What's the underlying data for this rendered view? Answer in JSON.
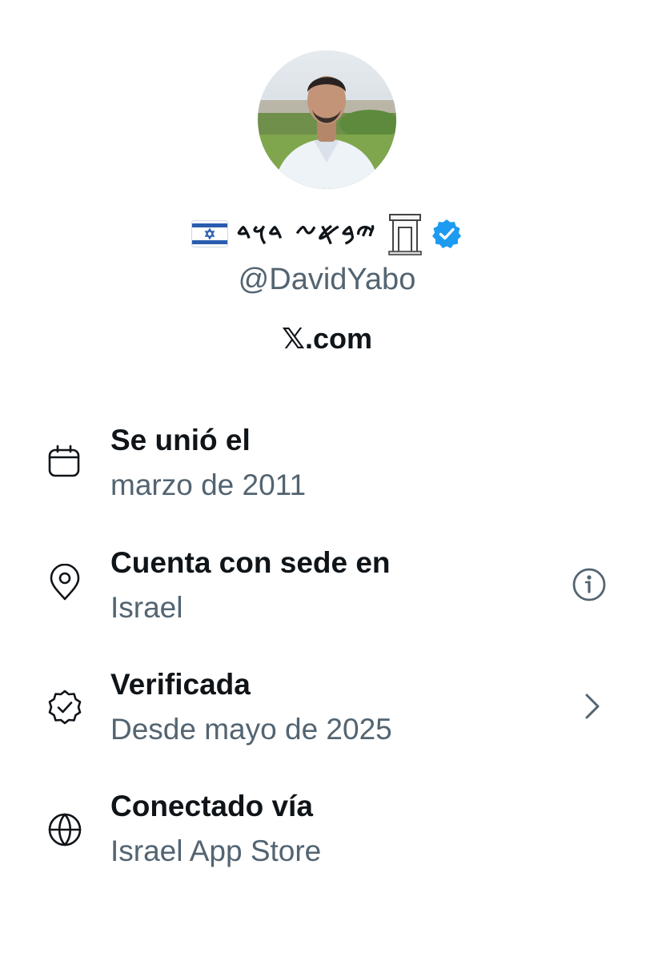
{
  "profile": {
    "display_name": "𐤉𐤁𐤀𐤆 𐤃𐤅𐤃",
    "handle": "@DavidYabo",
    "site_label": "𝕏.com",
    "flag_icon": "israel-flag-icon",
    "gate_icon": "gate-icon",
    "verified_icon": "verified-badge-icon",
    "verified_color": "#1d9bf0"
  },
  "info": [
    {
      "label": "Se unió el",
      "value": "marzo de 2011",
      "icon": "calendar-icon"
    },
    {
      "label": "Cuenta con sede en",
      "value": "Israel",
      "icon": "location-pin-icon",
      "action_icon": "info-icon"
    },
    {
      "label": "Verificada",
      "value": "Desde mayo de 2025",
      "icon": "verified-outline-icon",
      "action_icon": "chevron-right-icon"
    },
    {
      "label": "Conectado vía",
      "value": "Israel App Store",
      "icon": "globe-icon"
    }
  ],
  "colors": {
    "primary_text": "#0f1419",
    "secondary_text": "#536471",
    "background": "#ffffff"
  }
}
